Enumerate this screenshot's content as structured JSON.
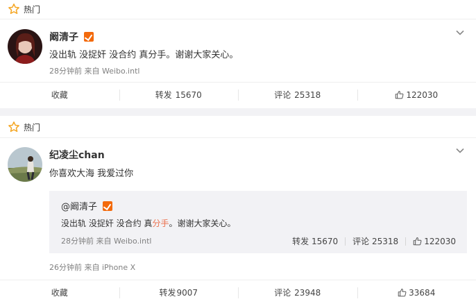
{
  "posts": [
    {
      "hot_label": "热门",
      "user": "阚清子",
      "text": "没出轨 没捉奸 没合约 真分手。谢谢大家关心。",
      "meta": "28分钟前 来自 Weibo.intl",
      "actions": {
        "favorite": "收藏",
        "repost_label": "转发",
        "repost_count": "15670",
        "comment_label": "评论",
        "comment_count": "25318",
        "like_count": "122030"
      }
    },
    {
      "hot_label": "热门",
      "user": "纪凌尘chan",
      "text": "你喜欢大海 我爱过你",
      "quote": {
        "user": "@阚清子",
        "text_before": "没出轨 没捉奸 没合约 真",
        "text_highlight": "分手",
        "text_after": "。谢谢大家关心。",
        "meta": "28分钟前 来自 Weibo.intl",
        "repost_label": "转发",
        "repost_count": "15670",
        "comment_label": "评论",
        "comment_count": "25318",
        "like_count": "122030"
      },
      "meta": "26分钟前 来自 iPhone X",
      "actions": {
        "favorite": "收藏",
        "repost_label": "转发",
        "repost_count": "9007",
        "comment_label": "评论",
        "comment_count": "23948",
        "like_count": "33684"
      }
    }
  ],
  "colors": {
    "accent": "#f36a0c",
    "highlight": "#eb7350",
    "meta_gray": "#808080"
  }
}
